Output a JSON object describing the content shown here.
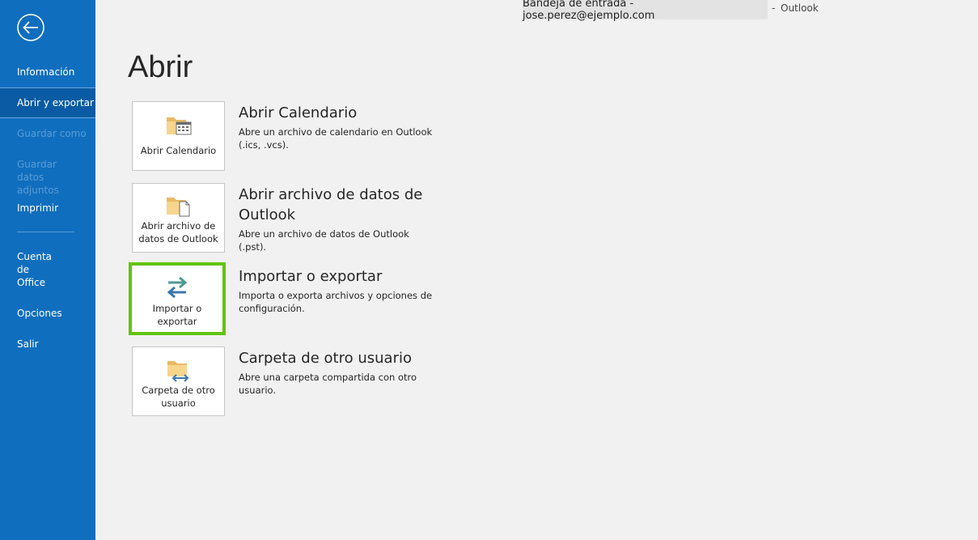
{
  "title_bar": {
    "account": "Bandeja de entrada - jose.perez@ejemplo.com",
    "separator": "-",
    "app_name": "Outlook"
  },
  "sidebar": {
    "back_icon": "back-arrow-circle-icon",
    "items": [
      {
        "label": "Información",
        "state": "normal"
      },
      {
        "label": "Abrir y exportar",
        "state": "selected"
      },
      {
        "label": "Guardar como",
        "state": "disabled"
      },
      {
        "label": "Guardar datos adjuntos",
        "state": "disabled"
      },
      {
        "label": "Imprimir",
        "state": "normal"
      },
      {
        "label": "Cuenta de Office",
        "state": "normal"
      },
      {
        "label": "Opciones",
        "state": "normal"
      },
      {
        "label": "Salir",
        "state": "normal"
      }
    ]
  },
  "main": {
    "title": "Abrir",
    "options": [
      {
        "tile_label": "Abrir Calendario",
        "heading": "Abrir Calendario",
        "description": "Abre un archivo de calendario en Outlook (.ics, .vcs).",
        "icon": "folder-calendar-icon"
      },
      {
        "tile_label": "Abrir archivo de datos de Outlook",
        "heading": "Abrir archivo de datos de Outlook",
        "description": "Abre un archivo de datos de Outlook (.pst).",
        "icon": "folder-document-icon"
      },
      {
        "tile_label": "Importar o exportar",
        "heading": "Importar o exportar",
        "description": "Importa o exporta archivos y opciones de configuración.",
        "icon": "import-export-arrows-icon",
        "highlighted": true
      },
      {
        "tile_label": "Carpeta de otro usuario",
        "heading": "Carpeta de otro usuario",
        "description": "Abre una carpeta compartida con otro usuario.",
        "icon": "shared-folder-icon"
      }
    ]
  },
  "colors": {
    "sidebar": "#106ebe",
    "sidebar_selected": "#0a5ba4",
    "highlight_border": "#62c40f",
    "background": "#f1f1f1"
  }
}
